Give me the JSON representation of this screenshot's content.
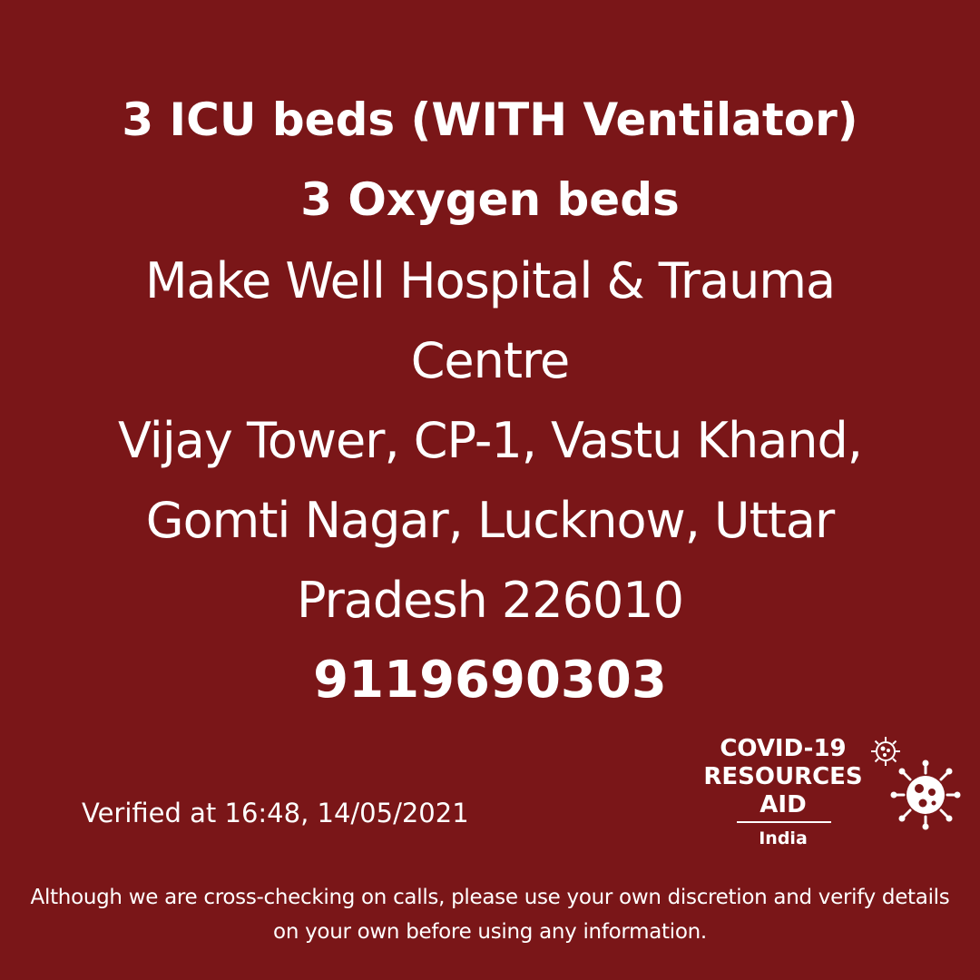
{
  "colors": {
    "background": "#7a1618",
    "text": "#ffffff"
  },
  "headline": {
    "line1": "3 ICU beds (WITH Ventilator)",
    "line2": "3 Oxygen beds"
  },
  "hospital": {
    "name": "Make Well Hospital & Trauma Centre",
    "address": "Vijay Tower, CP-1, Vastu Khand, Gomti Nagar, Lucknow, Uttar Pradesh 226010",
    "phone": "9119690303"
  },
  "verified": "Verified at 16:48, 14/05/2021",
  "logo": {
    "line1": "COVID-19",
    "line2": "RESOURCES",
    "line3": "AID",
    "country": "India",
    "icons": [
      "virus-icon",
      "virus-icon"
    ]
  },
  "disclaimer": "Although we are cross-checking on calls, please use your own discretion and verify details on your own before using any information."
}
